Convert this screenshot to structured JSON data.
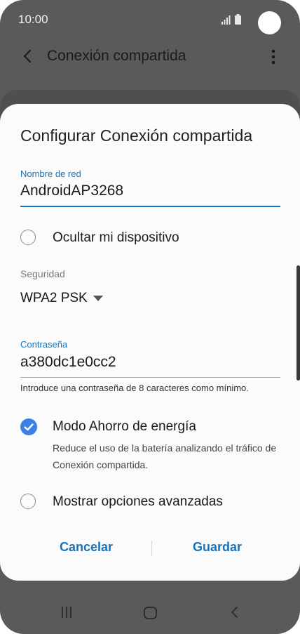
{
  "status": {
    "time": "10:00"
  },
  "appbar": {
    "title": "Conexión compartida"
  },
  "dialog": {
    "title": "Configurar Conexión compartida",
    "network_name": {
      "label": "Nombre de red",
      "value": "AndroidAP3268"
    },
    "hide_device": {
      "label": "Ocultar mi dispositivo",
      "checked": false
    },
    "security": {
      "label": "Seguridad",
      "value": "WPA2 PSK"
    },
    "password": {
      "label": "Contraseña",
      "value": "a380dc1e0cc2",
      "hint": "Introduce una contraseña de 8 caracteres como mínimo."
    },
    "power_saving": {
      "label": "Modo Ahorro de energía",
      "description": "Reduce el uso de la batería analizando el tráfico de Conexión compartida.",
      "checked": true
    },
    "advanced": {
      "label": "Mostrar opciones avanzadas",
      "checked": false
    },
    "buttons": {
      "cancel": "Cancelar",
      "save": "Guardar"
    }
  },
  "colors": {
    "accent": "#1a73b8",
    "check": "#3b80e6",
    "overlay": "#5a5a5a"
  },
  "icons": {
    "back": "back-arrow-icon",
    "more": "more-vert-icon",
    "recents": "recents-icon",
    "home": "home-icon",
    "back_nav": "back-nav-icon"
  }
}
